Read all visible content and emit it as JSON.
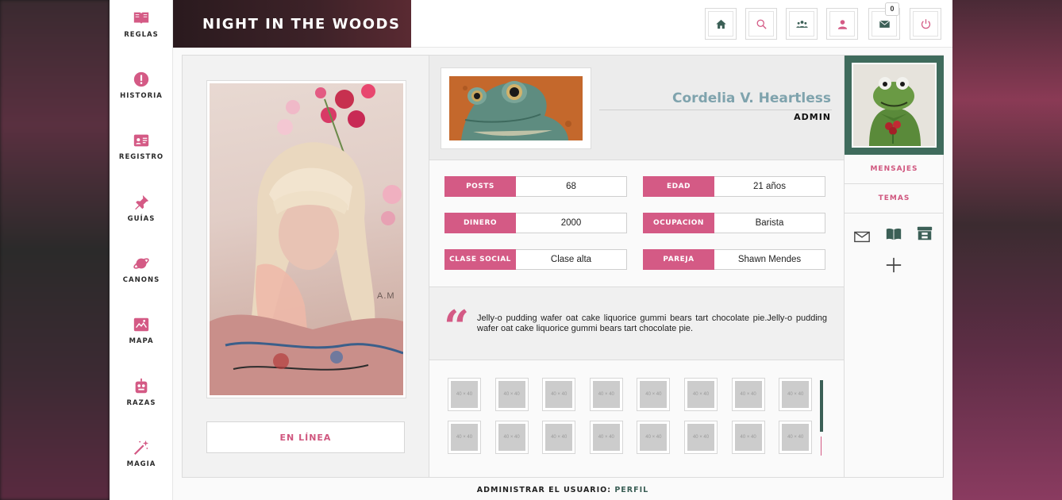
{
  "site": {
    "title": "NIGHT IN THE WOODS"
  },
  "sidebar": {
    "items": [
      {
        "label": "REGLAS",
        "icon": "book-icon"
      },
      {
        "label": "HISTORIA",
        "icon": "exclamation-icon"
      },
      {
        "label": "REGISTRO",
        "icon": "id-card-icon"
      },
      {
        "label": "GUÍAS",
        "icon": "pin-icon"
      },
      {
        "label": "CANONS",
        "icon": "planet-icon"
      },
      {
        "label": "MAPA",
        "icon": "map-icon"
      },
      {
        "label": "RAZAS",
        "icon": "robot-icon"
      },
      {
        "label": "MAGIA",
        "icon": "magic-wand-icon"
      }
    ]
  },
  "header": {
    "buttons": [
      {
        "name": "home",
        "icon": "home-icon"
      },
      {
        "name": "search",
        "icon": "search-icon"
      },
      {
        "name": "members",
        "icon": "users-icon"
      },
      {
        "name": "profile",
        "icon": "user-icon"
      },
      {
        "name": "messages",
        "icon": "envelope-icon",
        "badge": "0"
      },
      {
        "name": "logout",
        "icon": "power-icon"
      }
    ]
  },
  "profile": {
    "name": "Cordelia V. Heartless",
    "rank": "ADMIN",
    "status": "EN LÍNEA",
    "fields": [
      {
        "label": "POSTS",
        "value": "68"
      },
      {
        "label": "EDAD",
        "value": "21 años"
      },
      {
        "label": "DINERO",
        "value": "2000"
      },
      {
        "label": "OCUPACION",
        "value": "Barista"
      },
      {
        "label": "CLASE SOCIAL",
        "value": "Clase alta"
      },
      {
        "label": "PAREJA",
        "value": "Shawn Mendes"
      }
    ],
    "quote": "Jelly-o pudding wafer oat cake liquorice gummi bears tart chocolate pie.Jelly-o pudding wafer oat cake liquorice gummi bears tart chocolate pie.",
    "portrait_watermark": "A.M",
    "thumbnail_label": "40 × 40",
    "thumbnail_count": 16
  },
  "right_panel": {
    "links": [
      "MENSAJES",
      "TEMAS"
    ],
    "icons": [
      "envelope-icon",
      "book-open-icon",
      "archive-icon",
      "plus-icon"
    ]
  },
  "footer": {
    "prefix": "ADMINISTRAR EL USUARIO:",
    "link": "PERFIL"
  },
  "colors": {
    "accent": "#d45a85",
    "dark_green": "#3b5f56",
    "name_blue": "#7fa3ad"
  }
}
